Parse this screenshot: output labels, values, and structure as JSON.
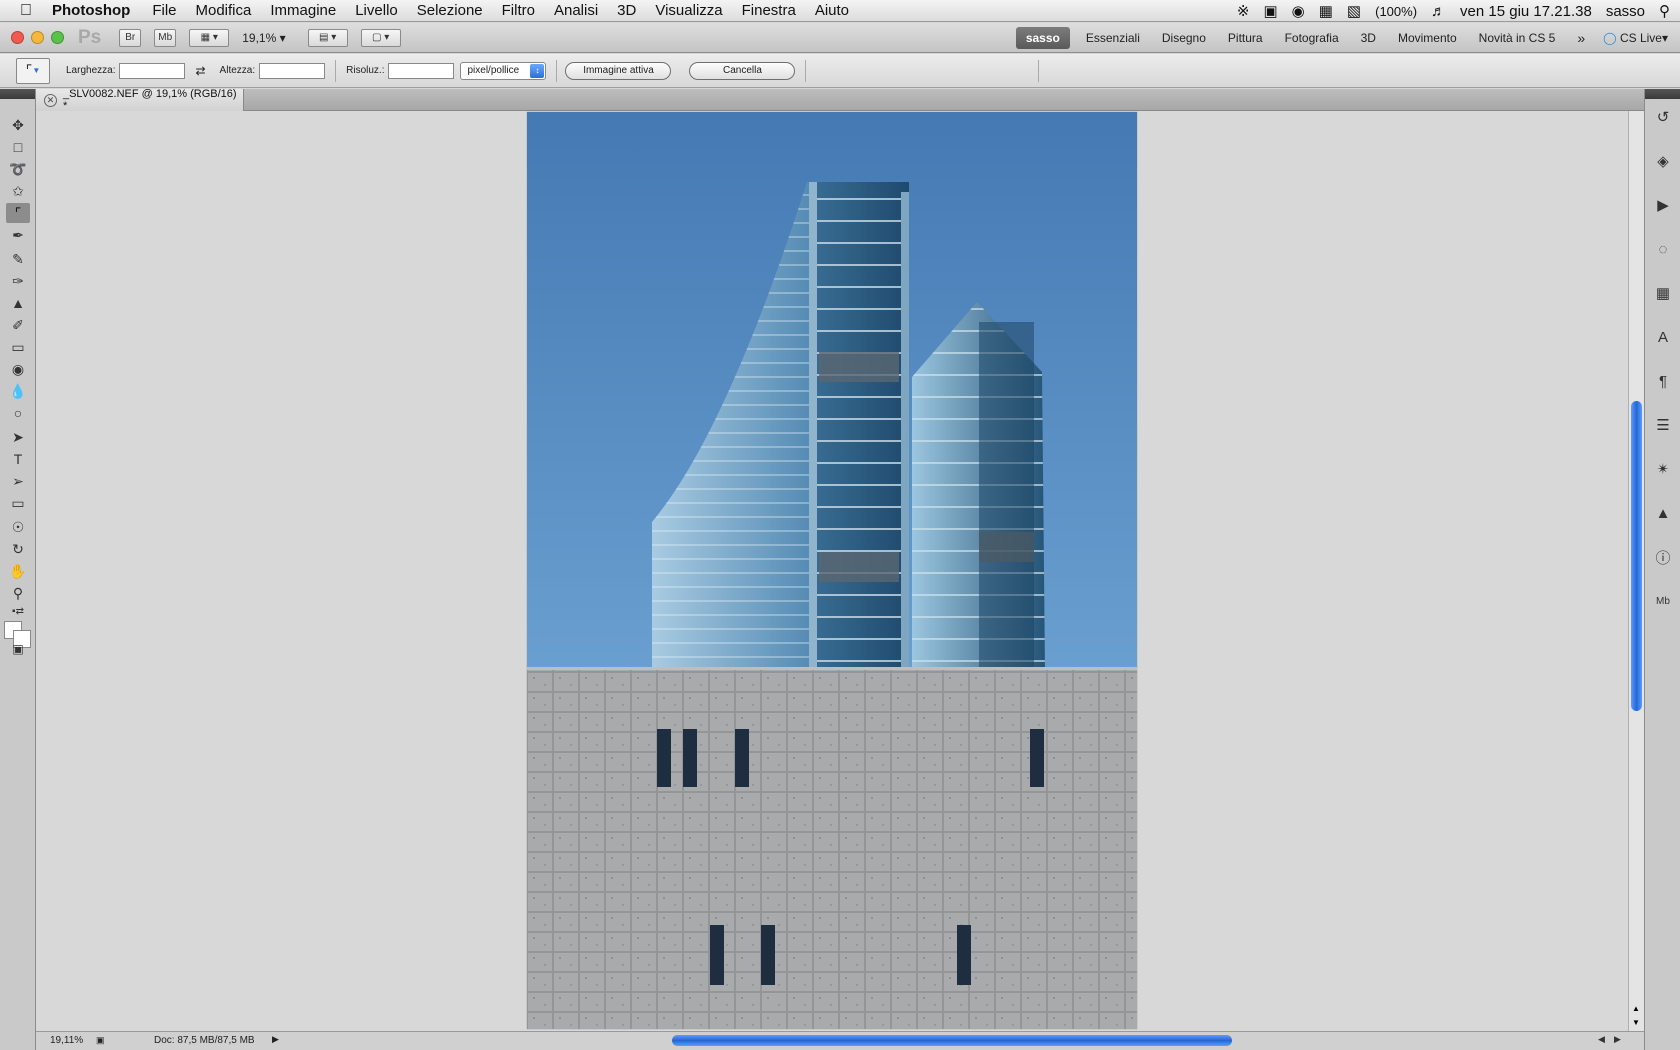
{
  "menubar": {
    "app_name": "Photoshop",
    "items": [
      "File",
      "Modifica",
      "Immagine",
      "Livello",
      "Selezione",
      "Filtro",
      "Analisi",
      "3D",
      "Visualizza",
      "Finestra",
      "Aiuto"
    ],
    "battery": "(100%)",
    "datetime": "ven 15 giu  17.21.38",
    "user": "sasso"
  },
  "appbar": {
    "logo": "Ps",
    "bridge_label": "Br",
    "minibridge_label": "Mb",
    "zoom": "19,1%",
    "workspaces": {
      "active": "sasso",
      "items": [
        "Essenziali",
        "Disegno",
        "Pittura",
        "Fotografia",
        "3D",
        "Movimento",
        "Novità in CS 5"
      ]
    },
    "cs_live": "CS Live"
  },
  "options": {
    "width_label": "Larghezza:",
    "width_value": "",
    "height_label": "Altezza:",
    "height_value": "",
    "resolution_label": "Risoluz.:",
    "resolution_value": "",
    "unit": "pixel/pollice",
    "front_image_button": "Immagine attiva",
    "clear_button": "Cancella"
  },
  "document": {
    "tab_title": "_SLV0082.NEF @ 19,1% (RGB/16) *"
  },
  "status": {
    "zoom": "19,11%",
    "doc_info": "Doc: 87,5 MB/87,5 MB"
  }
}
